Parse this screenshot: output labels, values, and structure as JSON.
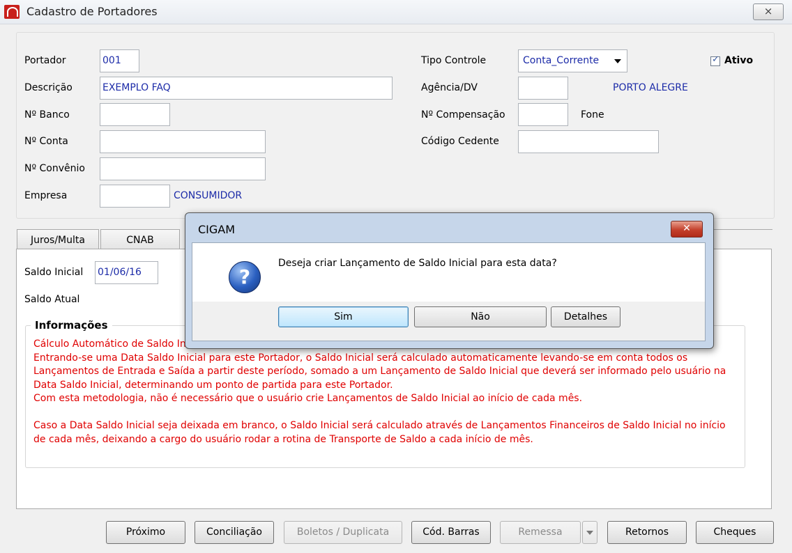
{
  "window": {
    "title": "Cadastro de Portadores",
    "close_glyph": "⨯"
  },
  "form": {
    "portador_label": "Portador",
    "portador_value": "001",
    "descricao_label": "Descrição",
    "descricao_value": "EXEMPLO FAQ",
    "banco_label": "Nº Banco",
    "banco_value": "",
    "conta_label": "Nº Conta",
    "conta_value": "",
    "convenio_label": "Nº Convênio",
    "convenio_value": "",
    "empresa_label": "Empresa",
    "empresa_value": "",
    "empresa_name": "CONSUMIDOR",
    "tipo_controle_label": "Tipo Controle",
    "tipo_controle_value": "Conta_Corrente",
    "ativo_label": "Ativo",
    "ativo_checked": true,
    "agencia_label": "Agência/DV",
    "agencia_value": "",
    "agencia_city": "PORTO ALEGRE",
    "compensacao_label": "Nº Compensação",
    "compensacao_value": "",
    "fone_label": "Fone",
    "cedente_label": "Código Cedente",
    "cedente_value": ""
  },
  "tabs": [
    {
      "label": "Juros/Multa"
    },
    {
      "label": "CNAB"
    }
  ],
  "panel": {
    "saldo_inicial_label": "Saldo Inicial",
    "saldo_inicial_value": "01/06/16",
    "saldo_atual_label": "Saldo Atual",
    "info_title": "Informações",
    "info_lines": [
      "Cálculo Automático de Saldo Ini",
      "Entrando-se uma Data Saldo Inicial para este Portador, o Saldo Inicial será calculado automaticamente levando-se em conta todos os",
      "Lançamentos de Entrada e Saída a partir deste período, somado a um Lançamento de Saldo Inicial que deverá ser informado pelo usuário na",
      "Data Saldo Inicial, determinando um ponto de partida para este Portador.",
      "Com esta metodologia, não é necessário que o usuário crie Lançamentos de Saldo Inicial ao início de cada mês.",
      "Caso a Data Saldo Inicial seja deixada em branco, o Saldo Inicial será calculado através de Lançamentos Financeiros de Saldo Inicial no início",
      "de cada mês, deixando a cargo do usuário rodar a rotina de Transporte de Saldo a cada início de mês."
    ]
  },
  "buttons": {
    "proximo": "Próximo",
    "conciliacao": "Conciliação",
    "boletos": "Boletos / Duplicata",
    "cod_barras": "Cód. Barras",
    "remessa": "Remessa",
    "retornos": "Retornos",
    "cheques": "Cheques"
  },
  "dialog": {
    "title": "CIGAM",
    "icon": "question-icon",
    "message": "Deseja criar Lançamento de Saldo Inicial para esta data?",
    "buttons": {
      "sim": "Sim",
      "nao": "Não",
      "detalhes": "Detalhes"
    }
  }
}
